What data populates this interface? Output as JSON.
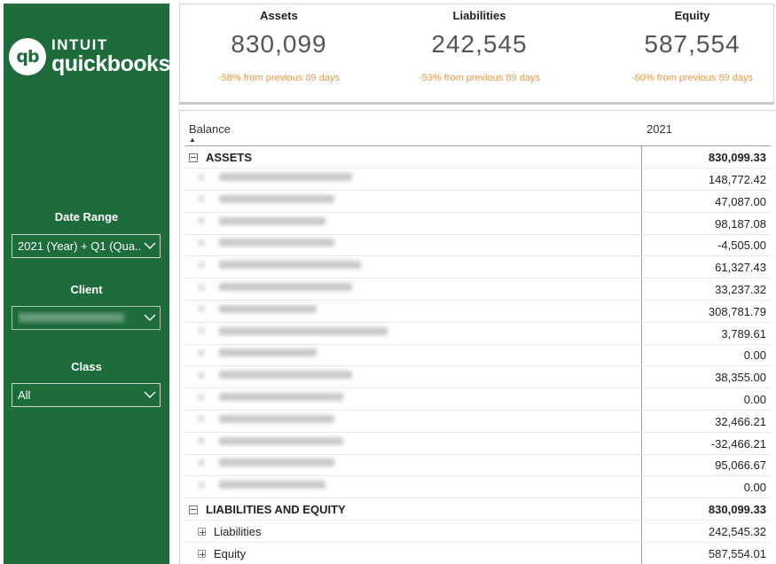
{
  "sidebar": {
    "brand": {
      "line1": "INTUIT",
      "line2": "quickbooks",
      "mark": "qb"
    },
    "filters": {
      "date_range": {
        "label": "Date Range",
        "value": "2021 (Year) + Q1 (Qua..."
      },
      "client": {
        "label": "Client",
        "value": ""
      },
      "class": {
        "label": "Class",
        "value": "All"
      }
    }
  },
  "kpis": [
    {
      "title": "Assets",
      "value": "830,099",
      "delta": "-58% from previous 89 days"
    },
    {
      "title": "Liabilities",
      "value": "242,545",
      "delta": "-53% from previous 89 days"
    },
    {
      "title": "Equity",
      "value": "587,554",
      "delta": "-60% from previous 89 days"
    }
  ],
  "table": {
    "col_balance": "Balance",
    "col_year": "2021",
    "sort_indicator": "▲",
    "assets": {
      "label": "ASSETS",
      "total": "830,099.33"
    },
    "asset_rows": [
      "148,772.42",
      "47,087.00",
      "98,187.08",
      "-4,505.00",
      "61,327.43",
      "33,237.32",
      "308,781.79",
      "3,789.61",
      "0.00",
      "38,355.00",
      "0.00",
      "32,466.21",
      "-32,466.21",
      "95,066.67",
      "0.00"
    ],
    "liab_equity": {
      "label": "LIABILITIES AND EQUITY",
      "total": "830,099.33"
    },
    "liabilities": {
      "label": "Liabilities",
      "value": "242,545.32"
    },
    "equity": {
      "label": "Equity",
      "value": "587,554.01"
    }
  },
  "colors": {
    "brand_green": "#1e6b3c",
    "delta_orange": "#e0994a",
    "divider_blue": "#7fa7c6"
  }
}
